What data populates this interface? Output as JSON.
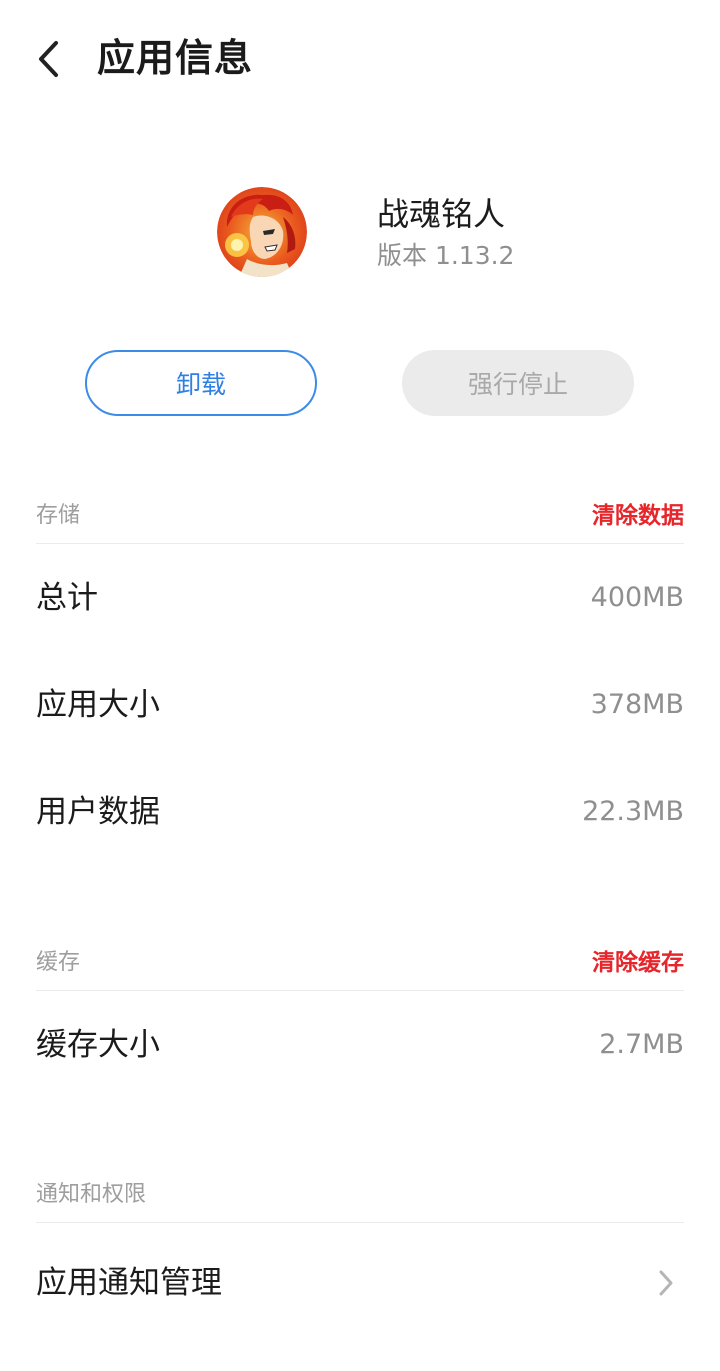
{
  "header": {
    "title": "应用信息",
    "back_icon": "chevron-left-icon"
  },
  "app": {
    "name": "战魂铭人",
    "version": "版本 1.13.2",
    "icon": "app-icon-anime-character"
  },
  "actions": {
    "uninstall_label": "卸载",
    "force_stop_label": "强行停止"
  },
  "storage": {
    "section_label": "存储",
    "clear_label": "清除数据",
    "rows": [
      {
        "label": "总计",
        "value": "400MB"
      },
      {
        "label": "应用大小",
        "value": "378MB"
      },
      {
        "label": "用户数据",
        "value": "22.3MB"
      }
    ]
  },
  "cache": {
    "section_label": "缓存",
    "clear_label": "清除缓存",
    "rows": [
      {
        "label": "缓存大小",
        "value": "2.7MB"
      }
    ]
  },
  "permissions": {
    "section_label": "通知和权限",
    "rows": [
      {
        "label": "应用通知管理"
      }
    ]
  },
  "colors": {
    "accent_blue": "#3c8ce7",
    "danger_red": "#e7262c",
    "muted_gray": "#8f8f8f"
  }
}
